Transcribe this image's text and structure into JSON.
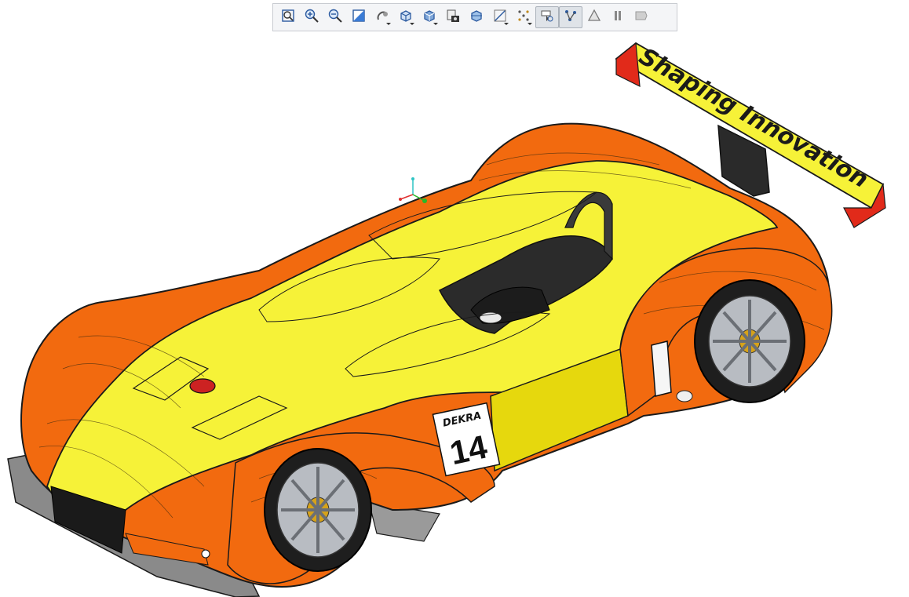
{
  "toolbar": {
    "buttons": [
      {
        "name": "zoom-area-icon",
        "active": false,
        "dropdown": false
      },
      {
        "name": "zoom-in-icon",
        "active": false,
        "dropdown": false
      },
      {
        "name": "zoom-out-icon",
        "active": false,
        "dropdown": false
      },
      {
        "name": "fit-view-icon",
        "active": false,
        "dropdown": false
      },
      {
        "name": "rotate-view-icon",
        "active": false,
        "dropdown": true
      },
      {
        "name": "view-orientation-icon",
        "active": false,
        "dropdown": true
      },
      {
        "name": "display-style-icon",
        "active": false,
        "dropdown": true
      },
      {
        "name": "snapshot-camera-icon",
        "active": false,
        "dropdown": false
      },
      {
        "name": "section-view-icon",
        "active": false,
        "dropdown": false
      },
      {
        "name": "sketch-plane-icon",
        "active": false,
        "dropdown": true
      },
      {
        "name": "show-relations-icon",
        "active": false,
        "dropdown": true
      },
      {
        "name": "selection-filter-icon",
        "active": true,
        "dropdown": false
      },
      {
        "name": "show-constraints-icon",
        "active": true,
        "dropdown": false
      },
      {
        "name": "render-mode-icon",
        "active": false,
        "dropdown": false
      },
      {
        "name": "pause-icon",
        "active": false,
        "dropdown": false
      },
      {
        "name": "exit-view-icon",
        "active": false,
        "dropdown": false
      }
    ]
  },
  "model": {
    "wing_decal": "Shaping Innovation",
    "side_decal": "DEKRA",
    "race_number": "14"
  },
  "colors": {
    "body_orange": "#f26a0f",
    "body_yellow": "#f6f238",
    "dark_side": "#e6d80d",
    "spoiler_red": "#e12a1a",
    "outline": "#1a1a1a"
  }
}
